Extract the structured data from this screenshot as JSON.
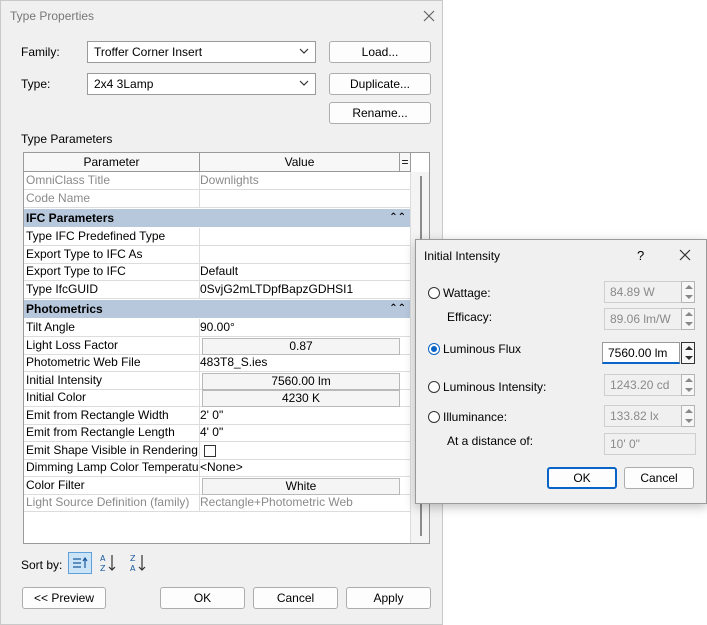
{
  "dialog": {
    "title": "Type Properties",
    "family_label": "Family:",
    "family_value": "Troffer Corner Insert",
    "type_label": "Type:",
    "type_value": "2x4 3Lamp",
    "load": "Load...",
    "duplicate": "Duplicate...",
    "rename": "Rename...",
    "type_parameters": "Type Parameters",
    "sort_by": "Sort by:",
    "preview": "<< Preview",
    "ok": "OK",
    "cancel": "Cancel",
    "apply": "Apply"
  },
  "grid": {
    "col_parameter": "Parameter",
    "col_value": "Value",
    "col_eq": "=",
    "rows_top": [
      {
        "p": "OmniClass Title",
        "v": "Downlights"
      },
      {
        "p": "Code Name",
        "v": ""
      }
    ],
    "group_ifc": "IFC Parameters",
    "rows_ifc": [
      {
        "p": "Type IFC Predefined Type",
        "v": ""
      },
      {
        "p": "Export Type to IFC As",
        "v": ""
      },
      {
        "p": "Export Type to IFC",
        "v": "Default"
      },
      {
        "p": "Type IfcGUID",
        "v": "0SvjG2mLTDpfBapzGDHSI1"
      }
    ],
    "group_photometrics": "Photometrics",
    "rows_photo": [
      {
        "p": "Tilt Angle",
        "v": "90.00°"
      },
      {
        "p": "Light Loss Factor",
        "v": "0.87"
      },
      {
        "p": "Photometric Web File",
        "v": "483T8_S.ies"
      },
      {
        "p": "Initial Intensity",
        "v": "7560.00 lm"
      },
      {
        "p": "Initial Color",
        "v": "4230 K"
      },
      {
        "p": "Emit from Rectangle Width",
        "v": "2'  0\""
      },
      {
        "p": "Emit from Rectangle Length",
        "v": "4'  0\""
      },
      {
        "p": "Emit Shape Visible in Rendering",
        "v": ""
      },
      {
        "p": "Dimming Lamp Color Temperatur",
        "v": "<None>"
      },
      {
        "p": "Color Filter",
        "v": "White"
      },
      {
        "p": "Light Source Definition (family)",
        "v": "Rectangle+Photometric Web"
      }
    ]
  },
  "popup": {
    "title": "Initial Intensity",
    "help": "?",
    "wattage_label": "Wattage:",
    "wattage_value": "84.89 W",
    "efficacy_label": "Efficacy:",
    "efficacy_value": "89.06 lm/W",
    "flux_label": "Luminous Flux",
    "flux_value": "7560.00 lm",
    "intensity_label": "Luminous Intensity:",
    "intensity_value": "1243.20 cd",
    "illuminance_label": "Illuminance:",
    "illuminance_value": "133.82 lx",
    "distance_label": "At a distance of:",
    "distance_value": "10'  0\"",
    "ok": "OK",
    "cancel": "Cancel"
  }
}
